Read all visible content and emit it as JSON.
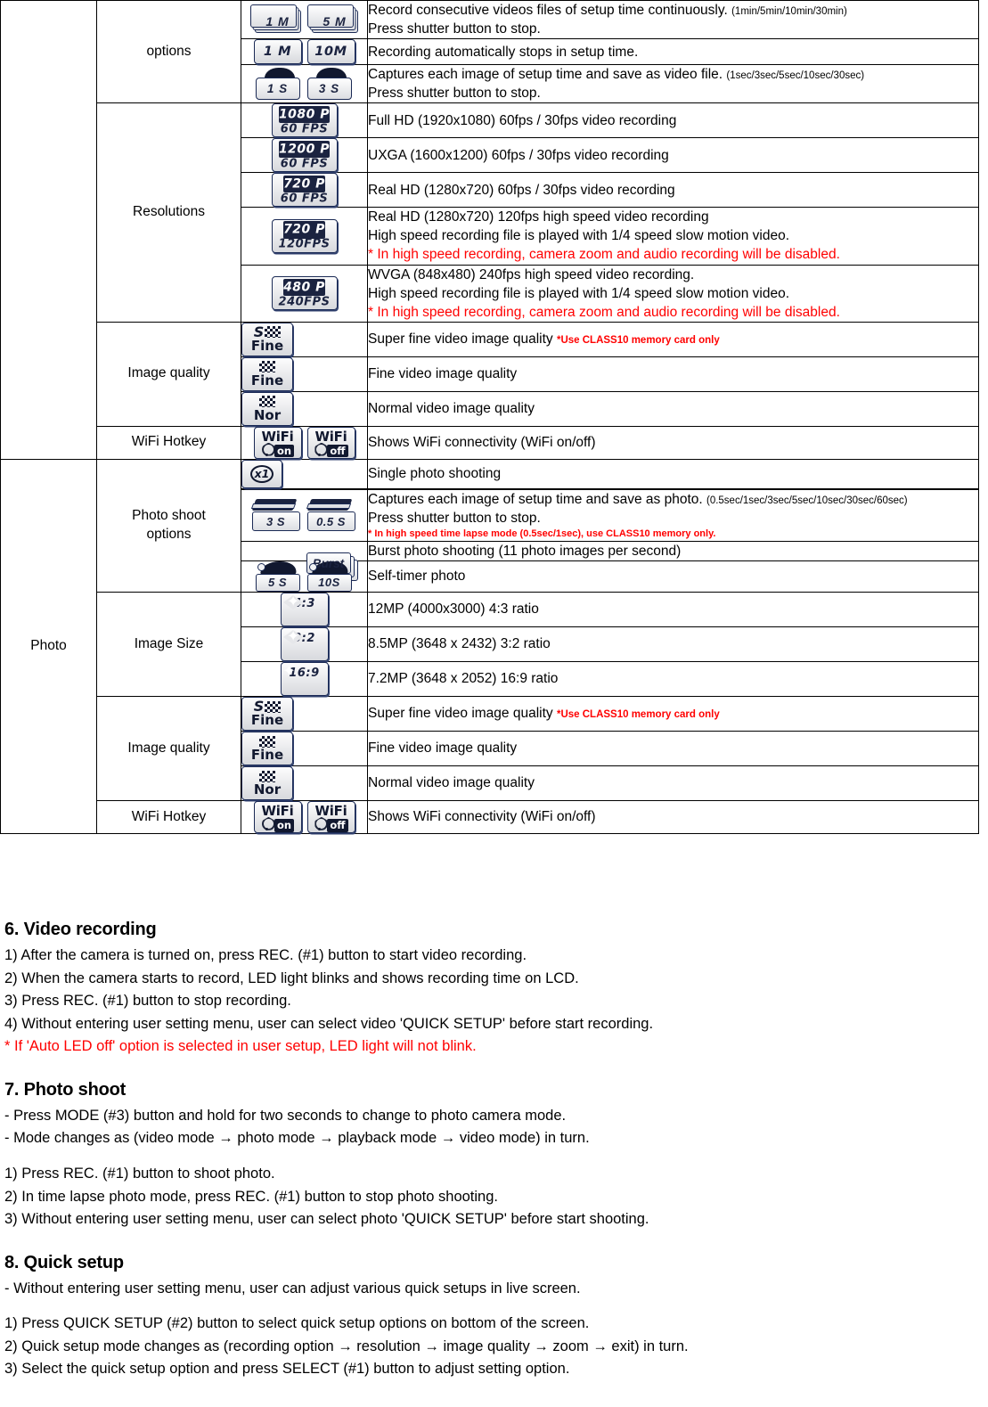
{
  "table": {
    "modes": {
      "video": "",
      "photo": "Photo"
    },
    "groups": {
      "video_options": "options",
      "resolutions": "Resolutions",
      "image_quality": "Image quality",
      "wifi_hotkey": "WiFi Hotkey",
      "photo_shoot_options_l1": "Photo shoot",
      "photo_shoot_options_l2": "options",
      "image_size": "Image Size"
    },
    "rows": {
      "video_timelapse_video": {
        "icons": [
          "1 M",
          "5 M"
        ],
        "line1": "Record consecutive videos files of setup time continuously.",
        "line1_note": "(1min/5min/10min/30min)",
        "line2": "Press shutter button to stop."
      },
      "video_autostop": {
        "icons": [
          "1 M",
          "10M"
        ],
        "line1": "Recording automatically stops in setup time."
      },
      "video_capture_interval": {
        "icons": [
          "1 S",
          "3 S"
        ],
        "line1": "Captures each image of setup time and save as video file.",
        "line1_note": "(1sec/3sec/5sec/10sec/30sec)",
        "line2": "Press shutter button to stop."
      },
      "res_1080p60": {
        "icon_top": "1080 P",
        "icon_bot": "60 FPS",
        "line1": "Full HD (1920x1080) 60fps / 30fps video recording"
      },
      "res_1200p60": {
        "icon_top": "1200 P",
        "icon_bot": "60 FPS",
        "line1": "UXGA (1600x1200) 60fps / 30fps video recording"
      },
      "res_720p60": {
        "icon_top": "720 P",
        "icon_bot": "60 FPS",
        "line1": "Real HD (1280x720) 60fps / 30fps video recording"
      },
      "res_720p120": {
        "icon_top": "720 P",
        "icon_bot": "120FPS",
        "line1": "Real HD (1280x720) 120fps high speed video recording",
        "line2": "High speed recording file is played with 1/4 speed slow motion video.",
        "line3": "* In high speed recording, camera zoom and audio recording will be disabled."
      },
      "res_480p240": {
        "icon_top": "480 P",
        "icon_bot": "240FPS",
        "line1": "WVGA (848x480) 240fps high speed video recording.",
        "line2": "High speed recording file is played with 1/4 speed slow motion video.",
        "line3": "* In high speed recording, camera zoom and audio recording will be disabled."
      },
      "video_q_superfine": {
        "icon_s": "S",
        "icon_label": "Fine",
        "line1": "Super fine video image quality",
        "note": "*Use CLASS10 memory card only"
      },
      "video_q_fine": {
        "icon_label": "Fine",
        "line1": "Fine video image quality"
      },
      "video_q_normal": {
        "icon_label": "Nor",
        "line1": "Normal video image quality"
      },
      "video_wifi": {
        "icon_on_top": "WiFi",
        "icon_on_bot": "on",
        "icon_off_top": "WiFi",
        "icon_off_bot": "off",
        "line1": "Shows WiFi connectivity (WiFi on/off)"
      },
      "photo_single": {
        "icon": "x1",
        "line1": "Single photo shooting"
      },
      "photo_timelapse": {
        "icons": [
          "3  S",
          "0.5 S"
        ],
        "line1": "Captures each image of setup time and save as photo.",
        "line1_note": "(0.5sec/1sec/3sec/5sec/10sec/30sec/60sec)",
        "line2": "Press shutter button to stop.",
        "line3": "* In high speed time lapse mode (0.5sec/1sec), use CLASS10 memory only."
      },
      "photo_burst": {
        "icon": "Burst",
        "line1": "Burst photo shooting (11 photo images per second)"
      },
      "photo_selftimer": {
        "icons": [
          "5 S",
          "10S"
        ],
        "line1": "Self-timer photo"
      },
      "size_12mp": {
        "icon_cap": "4:3",
        "line1": "12MP (4000x3000) 4:3 ratio"
      },
      "size_85mp": {
        "icon_cap": "3:2",
        "line1": "8.5MP (3648 x 2432) 3:2 ratio"
      },
      "size_72mp": {
        "icon_cap": "16:9",
        "line1": "7.2MP (3648 x 2052) 16:9 ratio"
      },
      "photo_q_superfine": {
        "icon_s": "S",
        "icon_label": "Fine",
        "line1": "Super fine video image quality",
        "note": "*Use CLASS10 memory card only"
      },
      "photo_q_fine": {
        "icon_label": "Fine",
        "line1": "Fine video image quality"
      },
      "photo_q_normal": {
        "icon_label": "Nor",
        "line1": "Normal video image quality"
      },
      "photo_wifi": {
        "icon_on_top": "WiFi",
        "icon_on_bot": "on",
        "icon_off_top": "WiFi",
        "icon_off_bot": "off",
        "line1": "Shows WiFi connectivity (WiFi on/off)"
      }
    }
  },
  "sections": {
    "s6": {
      "heading": "6. Video recording",
      "l1": "1) After the camera is turned on, press REC. (#1) button to start video recording.",
      "l2": "2) When the camera starts to record, LED light blinks and shows recording time on LCD.",
      "l3": "3) Press REC. (#1) button to stop recording.",
      "l4": "4) Without entering user setting menu, user can select video 'QUICK SETUP' before start recording.",
      "l5": "* If 'Auto LED off' option is selected in user setup, LED light will not blink."
    },
    "s7": {
      "heading": "7. Photo shoot",
      "l1": "- Press MODE (#3) button and hold for two seconds to change to photo camera mode.",
      "l2": "- Mode changes as (video mode → photo mode → playback mode → video mode) in turn.",
      "l3": "1) Press REC. (#1) button to shoot photo.",
      "l4": "2) In time lapse photo mode, press REC. (#1) button to stop photo shooting.",
      "l5": "3) Without entering user setting menu, user can select photo 'QUICK SETUP' before start shooting."
    },
    "s8": {
      "heading": "8. Quick setup",
      "l1": "- Without entering user setting menu, user can adjust various quick setups in live screen.",
      "l2": "1) Press QUICK SETUP (#2) button to select quick setup options on bottom of the screen.",
      "l3": "2) Quick setup mode changes as (recording option → resolution → image quality → zoom → exit) in turn.",
      "l4": "3) Select the quick setup option and press SELECT (#1) button to adjust setting option."
    }
  },
  "colors": {
    "accent_red": "#ff0000",
    "icon_navy": "#1b2340",
    "text_black": "#000000"
  }
}
